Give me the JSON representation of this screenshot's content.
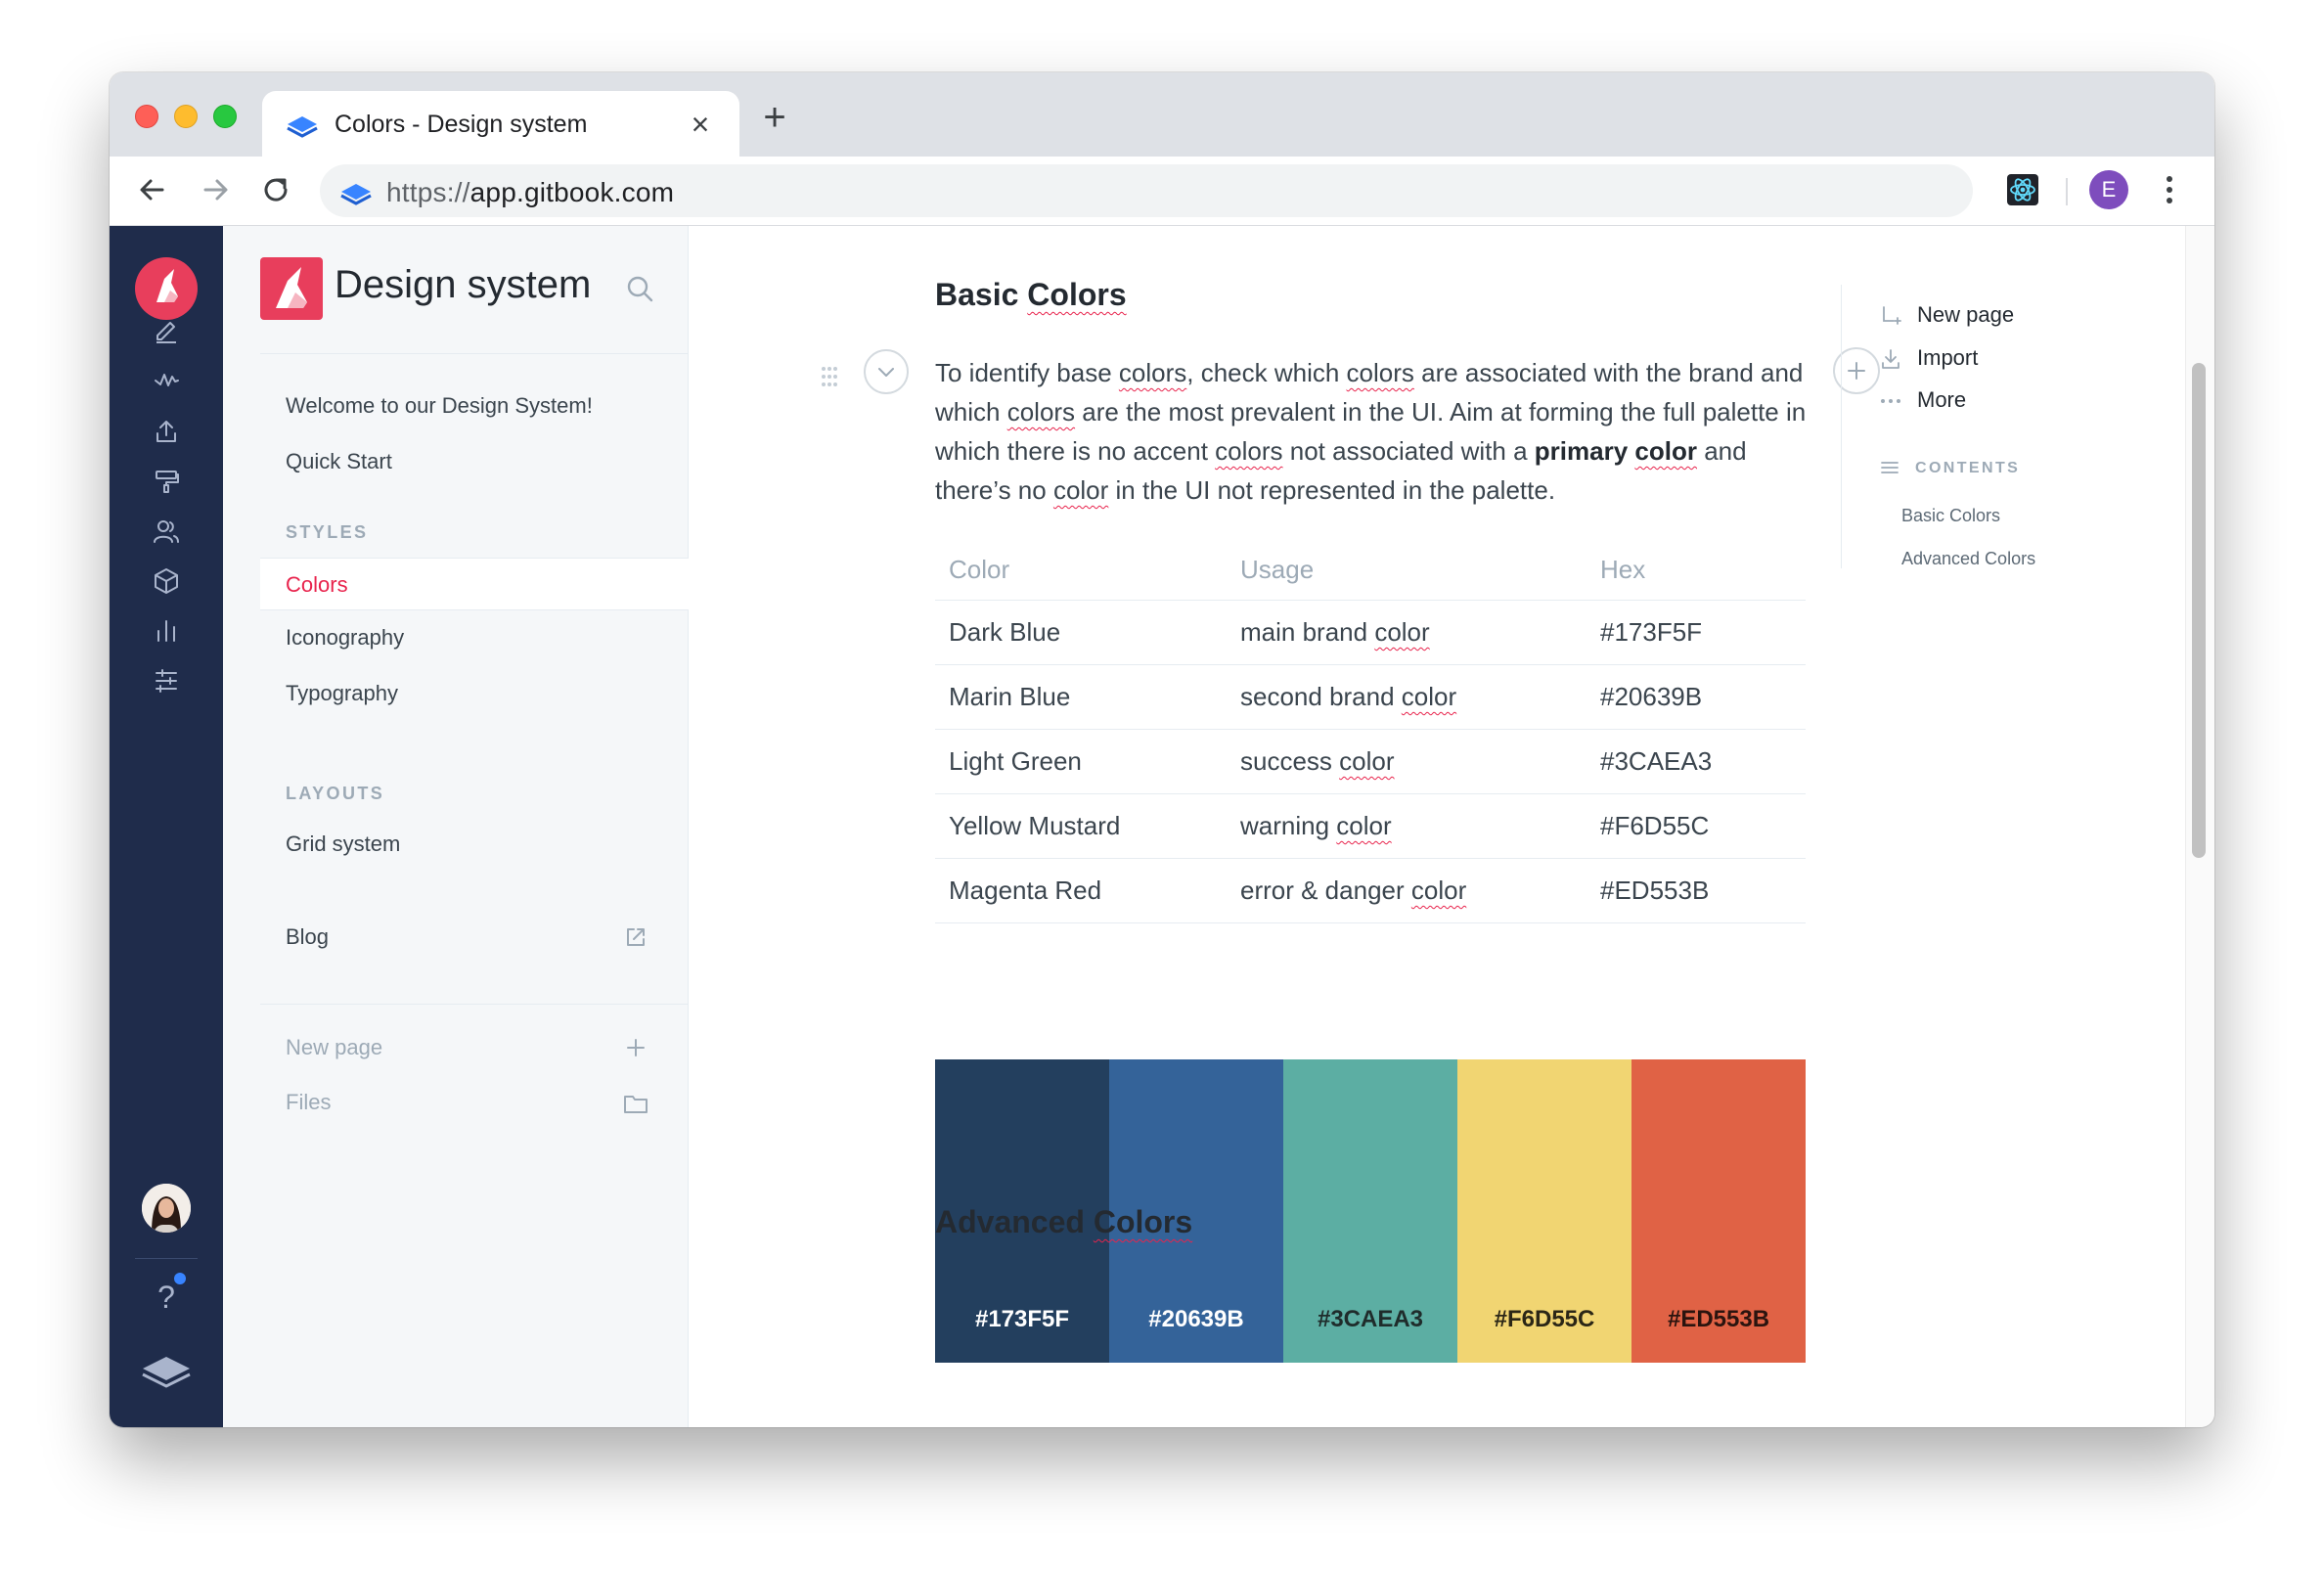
{
  "browser": {
    "tab_title": "Colors - Design system",
    "url_scheme": "https://",
    "url_host": "app.gitbook.com",
    "profile_initial": "E"
  },
  "rail": {
    "icons": [
      "edit-icon",
      "activity-icon",
      "upload-icon",
      "paint-roller-icon",
      "members-icon",
      "package-icon",
      "analytics-icon",
      "settings-sliders-icon"
    ],
    "help_label": "?"
  },
  "sidebar": {
    "space_title": "Design system",
    "items_top": [
      {
        "label": "Welcome to our Design System!"
      },
      {
        "label": "Quick Start"
      }
    ],
    "styles_heading": "STYLES",
    "styles_items": [
      {
        "label": "Colors",
        "active": true
      },
      {
        "label": "Iconography"
      },
      {
        "label": "Typography"
      }
    ],
    "layouts_heading": "LAYOUTS",
    "layouts_items": [
      {
        "label": "Grid system"
      }
    ],
    "blog_label": "Blog",
    "new_page_label": "New page",
    "files_label": "Files"
  },
  "page": {
    "basic_heading": "Basic Colors",
    "paragraph": {
      "p1": "To identify base ",
      "w1": "colors",
      "p2": ", check which ",
      "w2": "colors",
      "p3": " are associated with the brand and which ",
      "w3": "colors",
      "p4": " are the most prevalent in the UI. Aim at forming the full palette in which there is no accent ",
      "w4": "colors",
      "p5": " not associated with a ",
      "b1": "primary ",
      "w5": "color",
      "p6": " and there’s no ",
      "w6": "color",
      "p7": " in the UI not represented in the palette."
    },
    "table": {
      "headers": [
        "Color",
        "Usage",
        "Hex"
      ],
      "rows": [
        {
          "color": "Dark Blue",
          "usage_pre": "main brand ",
          "usage_word": "color",
          "hex": "#173F5F"
        },
        {
          "color": "Marin Blue",
          "usage_pre": "second brand ",
          "usage_word": "color",
          "hex": "#20639B"
        },
        {
          "color": "Light Green",
          "usage_pre": "success ",
          "usage_word": "color",
          "hex": "#3CAEA3"
        },
        {
          "color": "Yellow Mustard",
          "usage_pre": "warning ",
          "usage_word": "color",
          "hex": "#F6D55C"
        },
        {
          "color": "Magenta Red",
          "usage_pre": "error & danger ",
          "usage_word": "color",
          "hex": "#ED553B"
        }
      ]
    },
    "swatches": [
      {
        "label": "#173F5F",
        "bg": "#233f5e",
        "fg": "#ffffff"
      },
      {
        "label": "#20639B",
        "bg": "#346399",
        "fg": "#ffffff"
      },
      {
        "label": "#3CAEA3",
        "bg": "#5caea3",
        "fg": "#1f2c2b"
      },
      {
        "label": "#F6D55C",
        "bg": "#f1d572",
        "fg": "#2b2616"
      },
      {
        "label": "#ED553B",
        "bg": "#e06245",
        "fg": "#2b140f"
      }
    ],
    "advanced_heading": "Advanced Colors"
  },
  "right_panel": {
    "new_page": "New page",
    "import": "Import",
    "more": "More",
    "contents_heading": "CONTENTS",
    "contents_links": [
      "Basic Colors",
      "Advanced Colors"
    ]
  },
  "colors": {
    "rail_bg": "#1f2c4b",
    "brand": "#e83e5c",
    "active_link": "#e8234c"
  }
}
